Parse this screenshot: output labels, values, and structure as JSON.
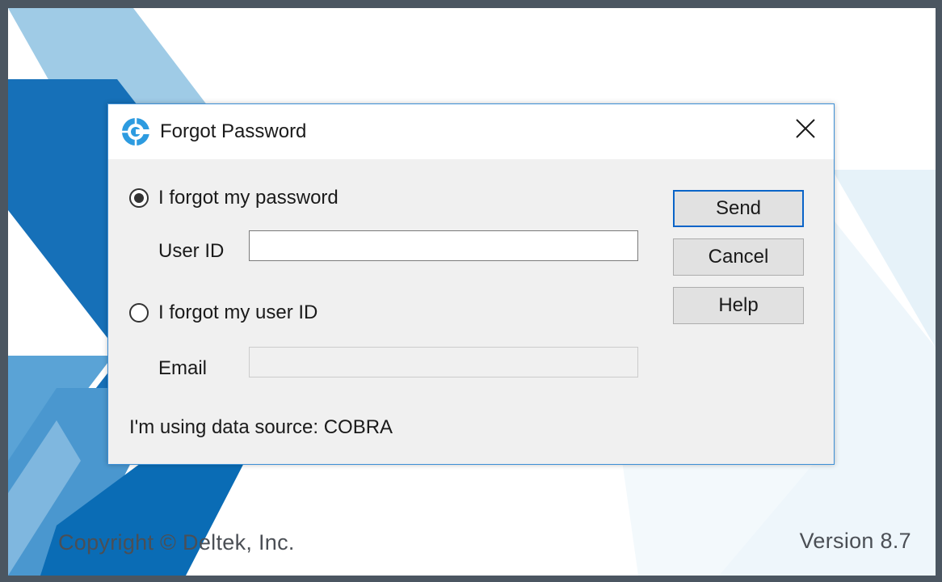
{
  "splash": {
    "copyright": "Copyright © Deltek, Inc.",
    "version": "Version 8.7",
    "colors": {
      "dark_blue": "#0a6cb5",
      "mid_blue": "#4a97cf",
      "light_blue": "#9fcbe6",
      "pale_blue": "#e6f2f9"
    }
  },
  "dialog": {
    "title": "Forgot Password",
    "icon": "cobra-logo-icon",
    "close_icon": "close-icon",
    "option_password": {
      "label": "I forgot my password",
      "selected": true
    },
    "userid_label": "User ID",
    "userid_value": "",
    "option_userid": {
      "label": "I forgot my user ID",
      "selected": false
    },
    "email_label": "Email",
    "email_value": "",
    "email_enabled": false,
    "datasource_text": "I'm using data source: COBRA",
    "buttons": {
      "send": "Send",
      "cancel": "Cancel",
      "help": "Help"
    },
    "accent_color": "#0a64c8"
  }
}
